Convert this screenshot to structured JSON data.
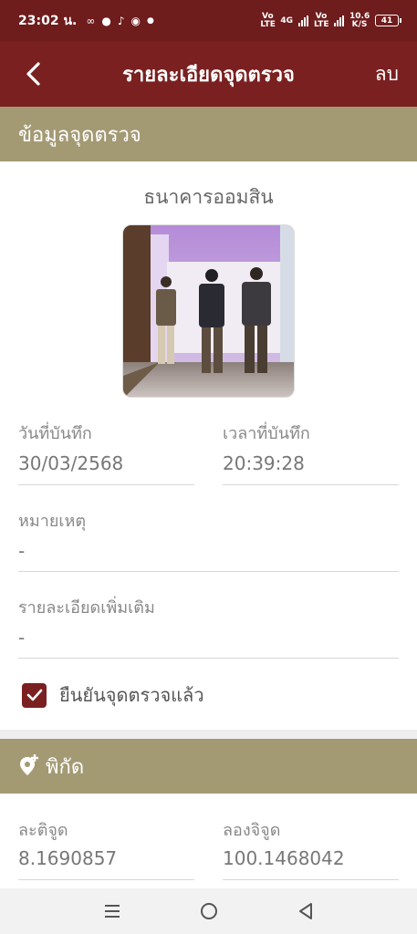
{
  "status_bar": {
    "time": "23:02 น.",
    "network_labels": [
      "Vo LTE",
      "4G",
      "Vo LTE"
    ],
    "speed": "10.6 K/S",
    "battery": "41"
  },
  "app_bar": {
    "title": "รายละเอียดจุดตรวจ",
    "delete_label": "ลบ",
    "back_icon": "chevron-left-icon"
  },
  "checkpoint_section": {
    "heading": "ข้อมูลจุดตรวจ",
    "place_name": "ธนาคารออมสิน",
    "record_date_label": "วันที่บันทึก",
    "record_date": "30/03/2568",
    "record_time_label": "เวลาที่บันทึก",
    "record_time": "20:39:28",
    "remark_label": "หมายเหตุ",
    "remark_value": "-",
    "details_label": "รายละเอียดเพิ่มเติม",
    "details_value": "-",
    "confirm_label": "ยืนยันจุดตรวจแล้ว",
    "confirm_checked": true
  },
  "location_section": {
    "heading": "พิกัด",
    "latitude_label": "ละติจูด",
    "latitude": "8.1690857",
    "longitude_label": "ลองจิจูด",
    "longitude": "100.1468042"
  },
  "colors": {
    "status_bar": "#6e1c1c",
    "app_bar": "#7a2020",
    "section_header": "#a39a74",
    "checkbox": "#7a2020"
  }
}
